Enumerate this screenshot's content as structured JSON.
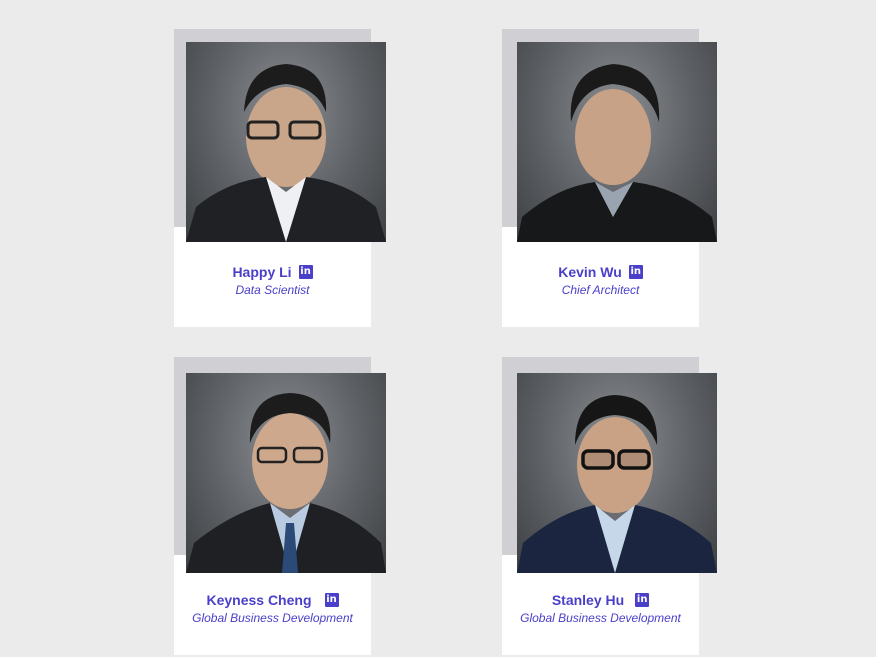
{
  "team": [
    {
      "name": "Happy Li",
      "title": "Data Scientist",
      "icon": "linkedin-icon",
      "photo": "portrait-photo"
    },
    {
      "name": "Kevin Wu",
      "title": "Chief Architect",
      "icon": "linkedin-icon",
      "photo": "portrait-photo"
    },
    {
      "name": "Keyness Cheng",
      "title": "Global Business Development",
      "icon": "linkedin-icon",
      "photo": "portrait-photo"
    },
    {
      "name": "Stanley Hu",
      "title": "Global Business Development",
      "icon": "linkedin-icon",
      "photo": "portrait-photo"
    }
  ],
  "linkedin_glyph": "in",
  "colors": {
    "accent": "#4a3fc9",
    "page_background": "#ebebeb",
    "card_background": "#ffffff",
    "photo_frame": "#cfcfd4"
  }
}
